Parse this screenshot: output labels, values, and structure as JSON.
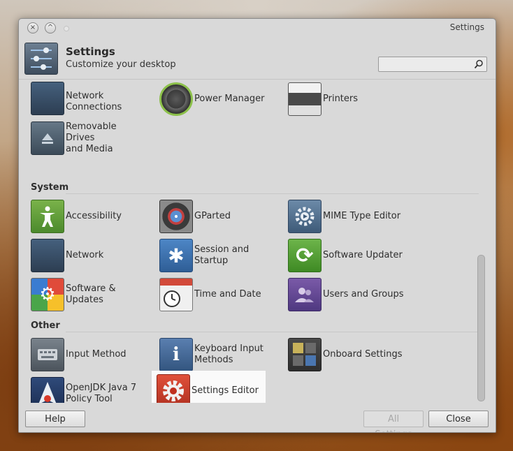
{
  "window": {
    "title": "Settings",
    "close_glyph": "×",
    "minimize_glyph": "^"
  },
  "header": {
    "title": "Settings",
    "subtitle": "Customize your desktop",
    "icon": "settings-sliders-icon"
  },
  "search": {
    "value": "",
    "placeholder": "",
    "icon": "search-icon"
  },
  "sections": {
    "system": "System",
    "other": "Other"
  },
  "items": {
    "network_connections": {
      "line1": "Network",
      "line2": "Connections",
      "icon": "network-connections-icon"
    },
    "power_manager": {
      "label": "Power Manager",
      "icon": "power-manager-icon"
    },
    "printers": {
      "label": "Printers",
      "icon": "printer-icon"
    },
    "removable_drives": {
      "line1": "Removable Drives",
      "line2": "and Media",
      "icon": "removable-drive-icon"
    },
    "accessibility": {
      "label": "Accessibility",
      "icon": "accessibility-icon"
    },
    "gparted": {
      "label": "GParted",
      "icon": "gparted-disk-icon"
    },
    "mime_type_editor": {
      "label": "MIME Type Editor",
      "icon": "mime-gear-icon"
    },
    "network": {
      "label": "Network",
      "icon": "network-icon"
    },
    "session_startup": {
      "label": "Session and Startup",
      "icon": "session-startup-icon"
    },
    "software_updater": {
      "label": "Software Updater",
      "icon": "software-updater-icon"
    },
    "software_updates": {
      "label": "Software & Updates",
      "icon": "software-updates-icon"
    },
    "time_date": {
      "label": "Time and Date",
      "icon": "clock-calendar-icon"
    },
    "users_groups": {
      "label": "Users and Groups",
      "icon": "users-icon"
    },
    "input_method": {
      "label": "Input Method",
      "icon": "keyboard-icon"
    },
    "keyboard_input_methods": {
      "line1": "Keyboard Input",
      "line2": "Methods",
      "icon": "info-keyboard-icon",
      "glyph": "i"
    },
    "onboard_settings": {
      "label": "Onboard Settings",
      "icon": "onboard-keyboard-icon"
    },
    "openjdk_policy": {
      "line1": "OpenJDK Java 7",
      "line2": "Policy Tool",
      "icon": "java-icon"
    },
    "settings_editor": {
      "label": "Settings Editor",
      "icon": "settings-editor-gear-icon"
    }
  },
  "buttons": {
    "help": "Help",
    "all_settings": "All Settings",
    "close": "Close"
  },
  "colors": {
    "highlight": "#fafafa",
    "window_bg": "#d9d9d9"
  }
}
